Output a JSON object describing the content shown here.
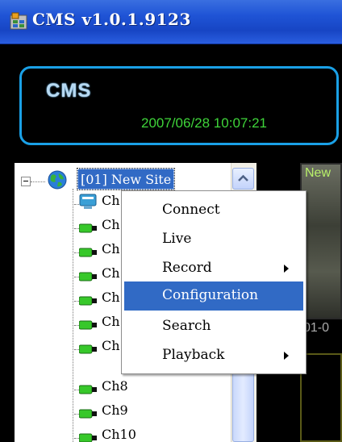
{
  "window": {
    "title": "CMS  v1.0.1.9123"
  },
  "header": {
    "logo": "CMS",
    "datetime": "2007/06/28 10:07:21"
  },
  "tree": {
    "site_label": "[01] New Site",
    "channels": [
      "Ch",
      "Ch",
      "Ch",
      "Ch",
      "Ch",
      "Ch",
      "Ch",
      "Ch8",
      "Ch9",
      "Ch10"
    ]
  },
  "video": {
    "title": "New",
    "time": "01-0"
  },
  "context_menu": {
    "items": [
      {
        "label": "Connect",
        "submenu": false
      },
      {
        "label": "Live",
        "submenu": false
      },
      {
        "label": "Record",
        "submenu": true
      },
      {
        "label": "Configuration",
        "submenu": false,
        "selected": true
      },
      {
        "label": "Search",
        "submenu": false
      },
      {
        "label": "Playback",
        "submenu": true
      }
    ]
  },
  "colors": {
    "titlebar": "#1f54d6",
    "header_border": "#1aa0e6",
    "datetime": "#3fd43a",
    "selection": "#316ac5"
  },
  "icons": {
    "app": "cms-app-icon",
    "site": "globe-icon",
    "camera": "camera-icon",
    "collapse": "tree-minus-icon",
    "scroll_up": "chevron-up-icon",
    "submenu": "submenu-arrow-icon"
  }
}
